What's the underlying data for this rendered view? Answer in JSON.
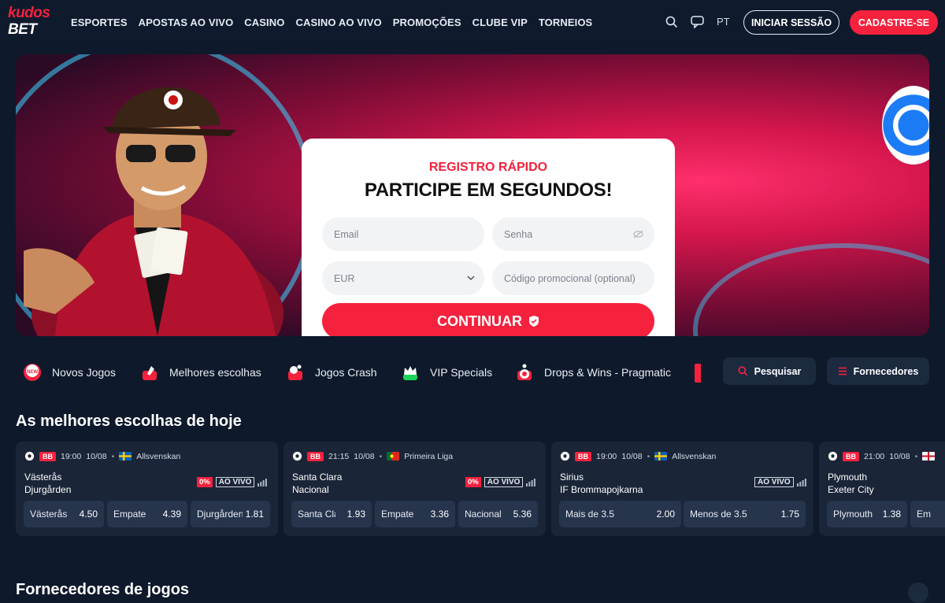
{
  "header": {
    "logo_top": "kudos",
    "logo_bottom": "BET",
    "nav": [
      "ESPORTES",
      "APOSTAS AO VIVO",
      "CASINO",
      "CASINO AO VIVO",
      "PROMOÇÕES",
      "CLUBE VIP",
      "TORNEIOS"
    ],
    "lang": "PT",
    "login": "INICIAR SESSÃO",
    "signup": "CADASTRE-SE"
  },
  "banner": {
    "subtitle": "REGISTRO RÁPIDO",
    "title": "PARTICIPE EM SEGUNDOS!",
    "email_placeholder": "Email",
    "password_placeholder": "Senha",
    "currency": "EUR",
    "promo_placeholder": "Código promocional (optional)",
    "continue": "CONTINUAR"
  },
  "categories": [
    {
      "label": "Novos Jogos",
      "icon": "new-icon"
    },
    {
      "label": "Melhores escolhas",
      "icon": "rocket-icon"
    },
    {
      "label": "Jogos Crash",
      "icon": "crash-icon"
    },
    {
      "label": "VIP Specials",
      "icon": "crown-icon"
    },
    {
      "label": "Drops & Wins - Pragmatic",
      "icon": "drops-icon"
    }
  ],
  "search": "Pesquisar",
  "providers": "Fornecedores",
  "section_title": "As melhores escolhas de hoje",
  "matches": [
    {
      "time": "19:00",
      "date": "10/08",
      "league": "Allsvenskan",
      "flag": "se",
      "home": "Västerås",
      "away": "Djurgården",
      "pct": "0%",
      "live": "AO VIVO",
      "odds": [
        {
          "label": "Västerås",
          "value": "4.50"
        },
        {
          "label": "Empate",
          "value": "4.39"
        },
        {
          "label": "Djurgården",
          "value": "1.81"
        }
      ]
    },
    {
      "time": "21:15",
      "date": "10/08",
      "league": "Primeira Liga",
      "flag": "pt",
      "home": "Santa Clara",
      "away": "Nacional",
      "pct": "0%",
      "live": "AO VIVO",
      "odds": [
        {
          "label": "Santa Clara",
          "value": "1.93"
        },
        {
          "label": "Empate",
          "value": "3.36"
        },
        {
          "label": "Nacional",
          "value": "5.36"
        }
      ]
    },
    {
      "time": "19:00",
      "date": "10/08",
      "league": "Allsvenskan",
      "flag": "se",
      "home": "Sirius",
      "away": "IF Brommapojkarna",
      "pct": "",
      "live": "AO VIVO",
      "odds": [
        {
          "label": "Mais de 3.5",
          "value": "2.00"
        },
        {
          "label": "Menos de 3.5",
          "value": "1.75"
        }
      ]
    },
    {
      "time": "21:00",
      "date": "10/08",
      "league": "",
      "flag": "en",
      "home": "Plymouth",
      "away": "Exeter City",
      "pct": "",
      "live": "",
      "odds": [
        {
          "label": "Plymouth",
          "value": "1.38"
        },
        {
          "label": "Em",
          "value": ""
        }
      ]
    }
  ],
  "next_section": "Fornecedores de jogos",
  "colors": {
    "accent": "#f5213d",
    "bg": "#0e1a2b",
    "card": "#1a2538"
  }
}
